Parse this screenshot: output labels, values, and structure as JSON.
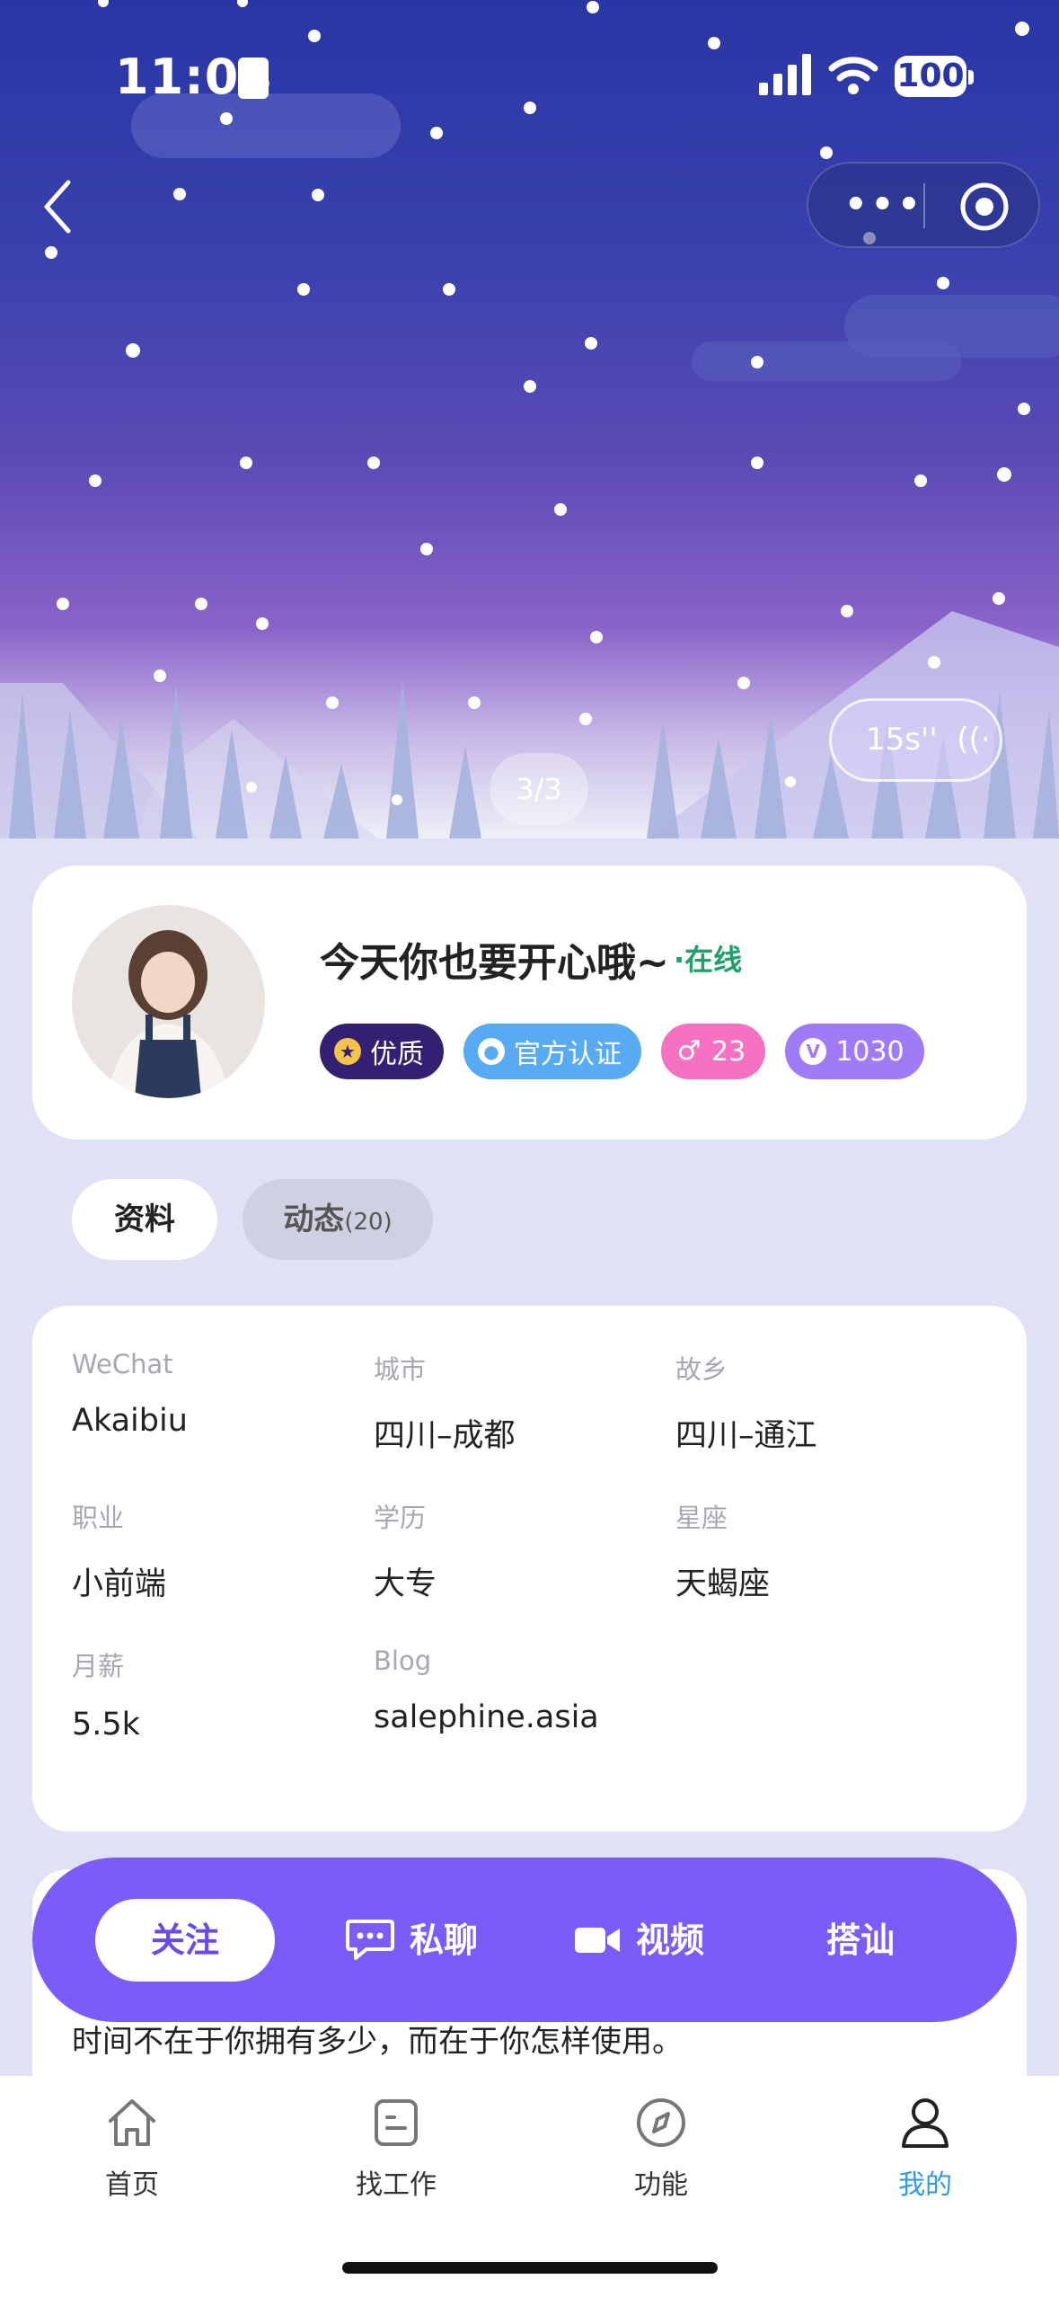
{
  "status_bar": {
    "time": "11:03",
    "battery": "100"
  },
  "hero": {
    "timer_label": "15s''",
    "pager": "3/3"
  },
  "profile": {
    "nickname": "今天你也要开心哦~",
    "online_status": "·在线",
    "badges": [
      {
        "label": "优质",
        "icon": "star-icon"
      },
      {
        "label": "官方认证",
        "icon": "verified-user-icon"
      },
      {
        "label": "23",
        "icon": "male-icon"
      },
      {
        "label": "1030",
        "icon": "v-icon"
      }
    ]
  },
  "tabs": [
    {
      "label": "资料"
    },
    {
      "label": "动态",
      "count": "(20)"
    }
  ],
  "info": [
    {
      "label": "WeChat",
      "value": "Akaibiu"
    },
    {
      "label": "城市",
      "value": "四川–成都"
    },
    {
      "label": "故乡",
      "value": "四川–通江"
    },
    {
      "label": "职业",
      "value": "小前端"
    },
    {
      "label": "学历",
      "value": "大专"
    },
    {
      "label": "星座",
      "value": "天蝎座"
    },
    {
      "label": "月薪",
      "value": "5.5k"
    },
    {
      "label": "Blog",
      "value": "salephine.asia"
    }
  ],
  "quote": "时间不在于你拥有多少，而在于你怎样使用。",
  "actions": {
    "follow": "关注",
    "chat": "私聊",
    "video": "视频",
    "greet": "搭讪"
  },
  "nav": [
    {
      "label": "首页",
      "icon": "home-icon"
    },
    {
      "label": "找工作",
      "icon": "job-icon"
    },
    {
      "label": "功能",
      "icon": "compass-icon"
    },
    {
      "label": "我的",
      "icon": "user-icon"
    }
  ],
  "colors": {
    "accent": "#7b5cf6",
    "online": "#21a06a",
    "active_nav": "#2f9be8"
  }
}
